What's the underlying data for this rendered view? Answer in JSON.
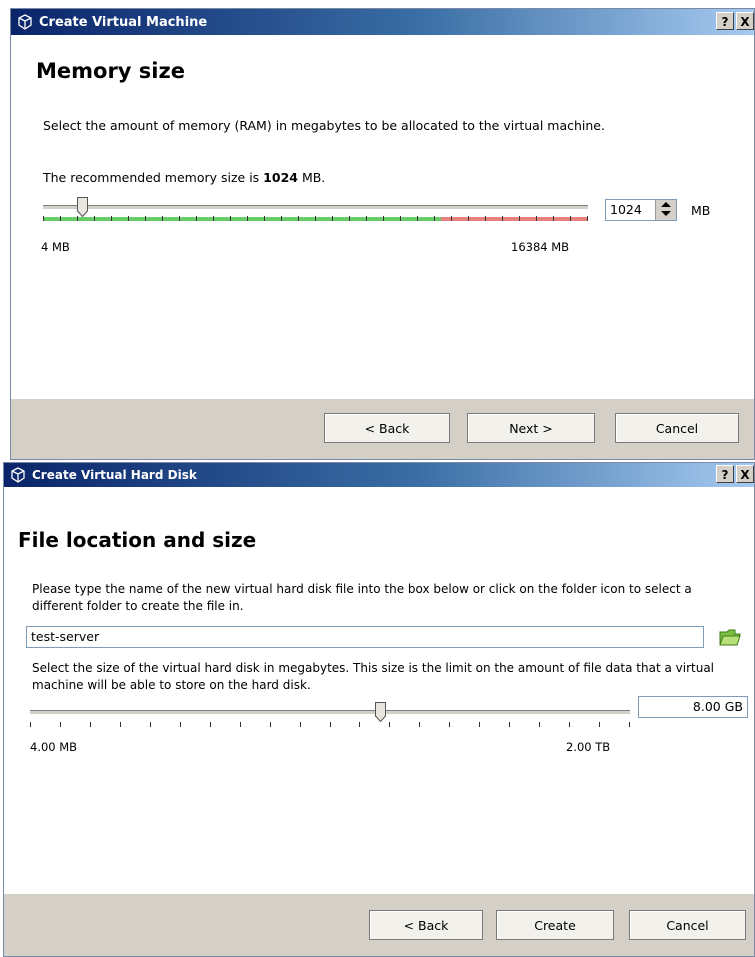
{
  "memory_dialog": {
    "title": "Create Virtual Machine",
    "help_button": "?",
    "close_button": "X",
    "heading": "Memory size",
    "description": "Select the amount of memory (RAM) in megabytes to be allocated to the virtual machine.",
    "recommend_prefix": "The recommended memory size is ",
    "recommend_value": "1024",
    "recommend_suffix": " MB.",
    "slider": {
      "min_label": "4 MB",
      "max_label": "16384 MB",
      "value_fraction": 0.062
    },
    "input_value": "1024",
    "unit": "MB",
    "buttons": {
      "back": "< Back",
      "next": "Next >",
      "cancel": "Cancel"
    },
    "colors": {
      "safe_zone": "#66cc66",
      "danger_zone": "#e88080"
    }
  },
  "disk_dialog": {
    "title": "Create Virtual Hard Disk",
    "help_button": "?",
    "close_button": "X",
    "heading": "File location and size",
    "description": "Please type the name of the new virtual hard disk file into the box below or click on the folder icon to select a different folder to create the file in.",
    "file_value": "test-server",
    "size_description": "Select the size of the virtual hard disk in megabytes. This size is the limit on the amount of file data that a virtual machine will be able to store on the hard disk.",
    "slider": {
      "min_label": "4.00 MB",
      "max_label": "2.00 TB",
      "value_fraction": 0.575
    },
    "size_value": "8.00 GB",
    "buttons": {
      "back": "< Back",
      "create": "Create",
      "cancel": "Cancel"
    }
  }
}
